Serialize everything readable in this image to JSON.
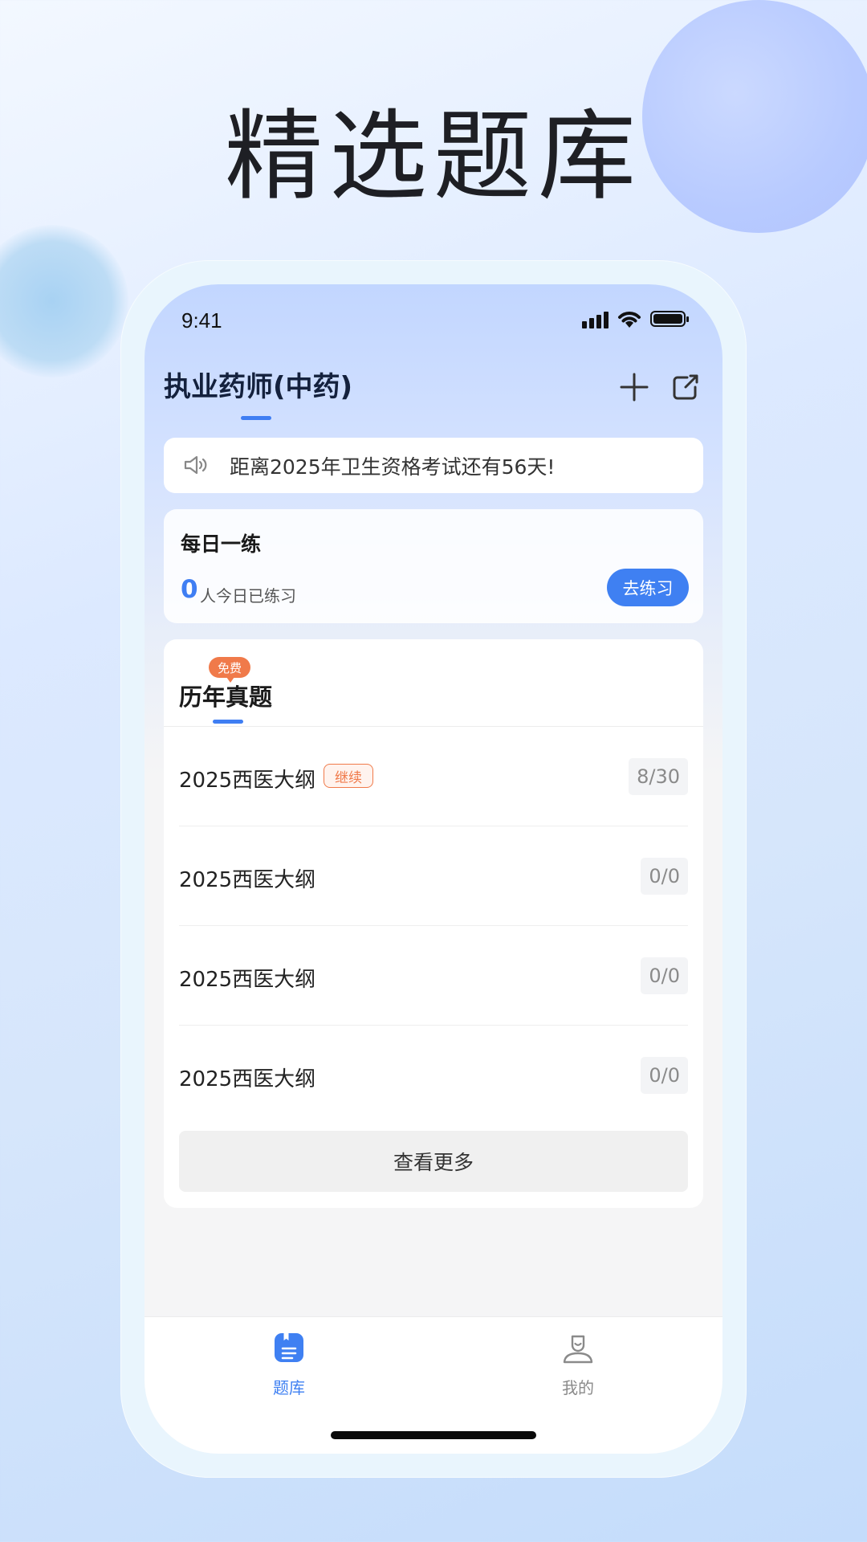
{
  "hero": {
    "title": "精选题库"
  },
  "status_bar": {
    "time": "9:41"
  },
  "header": {
    "title": "执业药师(中药)",
    "add_icon": "plus-icon",
    "share_icon": "share-icon"
  },
  "notice": {
    "icon": "speaker-icon",
    "text": "距离2025年卫生资格考试还有56天!"
  },
  "daily": {
    "title": "每日一练",
    "count": "0",
    "count_label": "人今日已练习",
    "button": "去练习"
  },
  "exams": {
    "badge": "免费",
    "tab": "历年真题",
    "continue_label": "继续",
    "items": [
      {
        "label": "2025西医大纲",
        "progress": "8/30",
        "continue": true
      },
      {
        "label": "2025西医大纲",
        "progress": "0/0"
      },
      {
        "label": "2025西医大纲",
        "progress": "0/0"
      },
      {
        "label": "2025西医大纲",
        "progress": "0/0"
      }
    ],
    "more_button": "查看更多"
  },
  "tabbar": {
    "items": [
      {
        "label": "题库",
        "icon": "question-bank-icon",
        "active": true,
        "color": "#3f80f2"
      },
      {
        "label": "我的",
        "icon": "profile-icon",
        "active": false,
        "color": "#8a8a8a"
      }
    ]
  },
  "colors": {
    "accent": "#3f80f2",
    "badge": "#f07a4a"
  }
}
